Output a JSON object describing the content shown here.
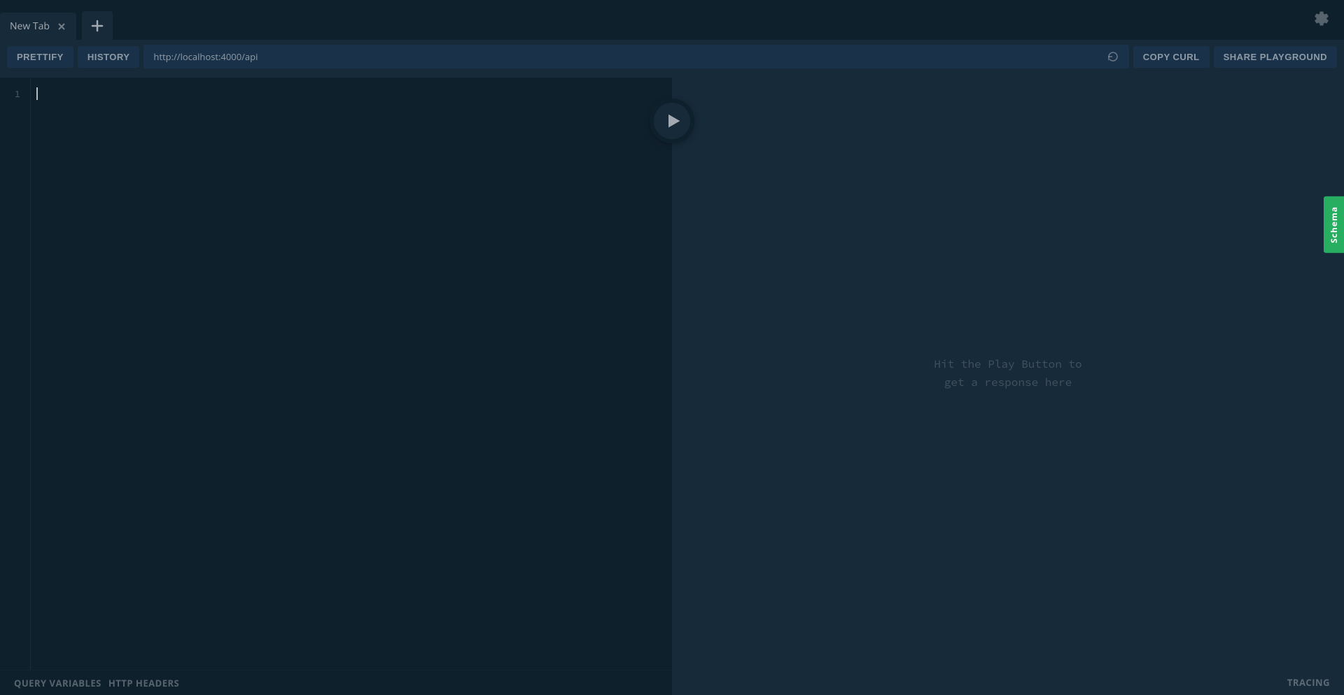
{
  "tabs": {
    "items": [
      {
        "label": "New Tab"
      }
    ]
  },
  "toolbar": {
    "prettify": "Prettify",
    "history": "History",
    "endpoint_value": "http://localhost:4000/api",
    "copy_curl": "Copy CURL",
    "share_playground": "Share Playground"
  },
  "editor": {
    "line_number": "1"
  },
  "editor_footer": {
    "query_variables": "Query Variables",
    "http_headers": "HTTP Headers"
  },
  "result": {
    "placeholder": "Hit the Play Button to\nget a response here"
  },
  "result_footer": {
    "tracing": "Tracing"
  },
  "side_tabs": {
    "schema": "Schema"
  }
}
